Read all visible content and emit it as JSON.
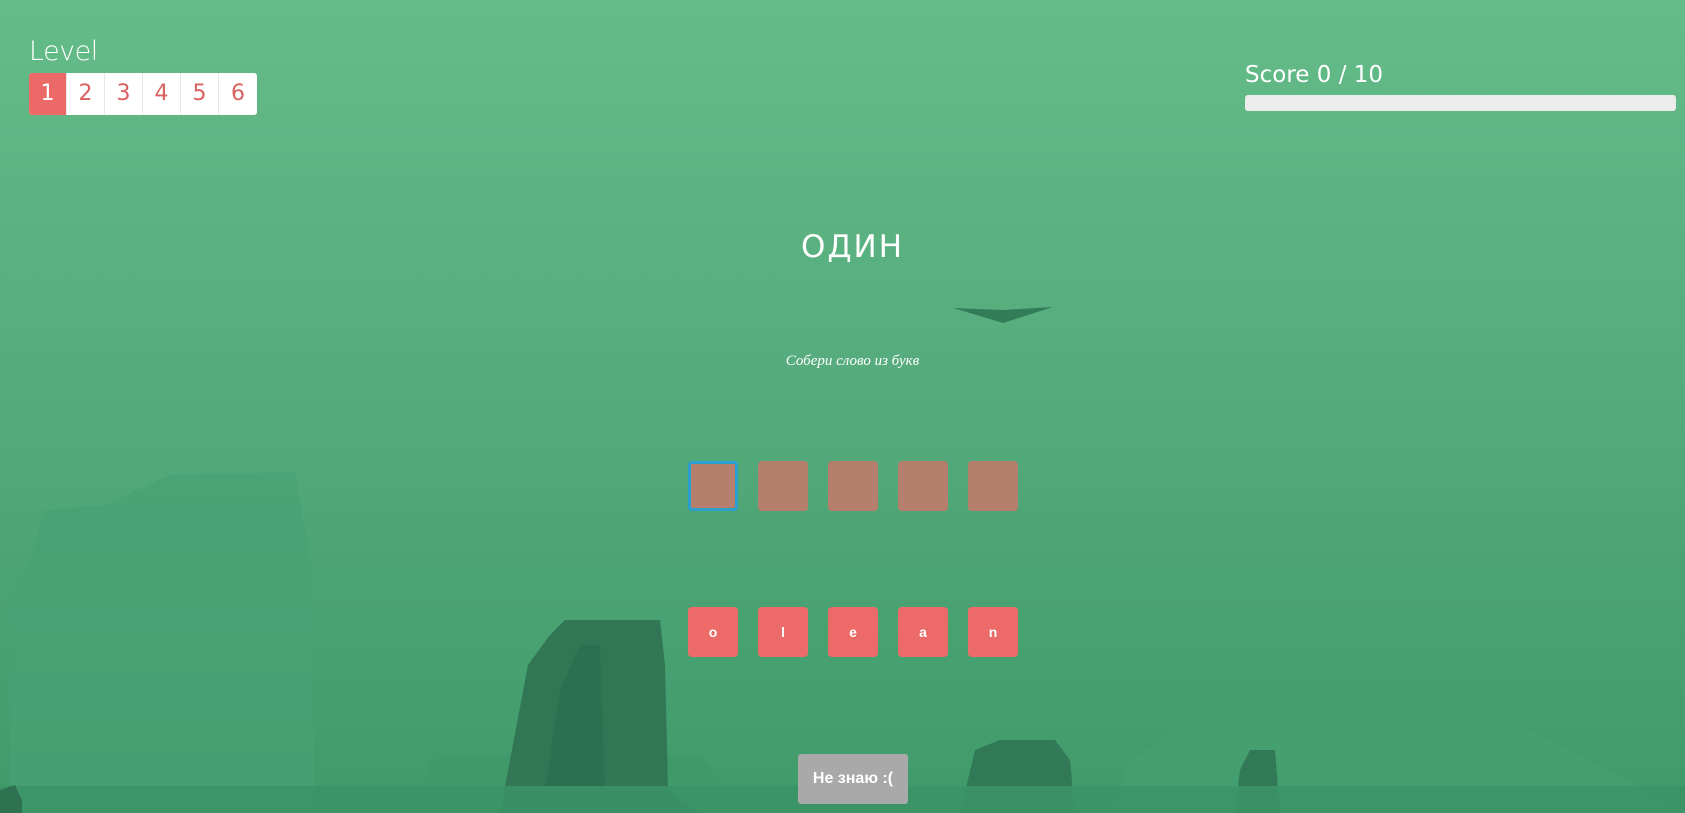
{
  "level": {
    "title": "Level",
    "items": [
      "1",
      "2",
      "3",
      "4",
      "5",
      "6"
    ],
    "active_index": 0
  },
  "score": {
    "label": "Score",
    "current": "0",
    "separator": "/",
    "total": "10",
    "progress": 0
  },
  "game": {
    "word": "ОДИН",
    "hint": "Собери слово из букв",
    "slot_count": 5,
    "letters": [
      "o",
      "l",
      "e",
      "a",
      "n"
    ],
    "dont_know_label": "Не знаю :("
  },
  "colors": {
    "accent": "#eb6a68",
    "slot": "#b57e6d",
    "slot_focus": "#2a9fd0",
    "button_gray": "#a9a9a9"
  },
  "icons": {
    "arrow": "chevron-down-icon"
  }
}
